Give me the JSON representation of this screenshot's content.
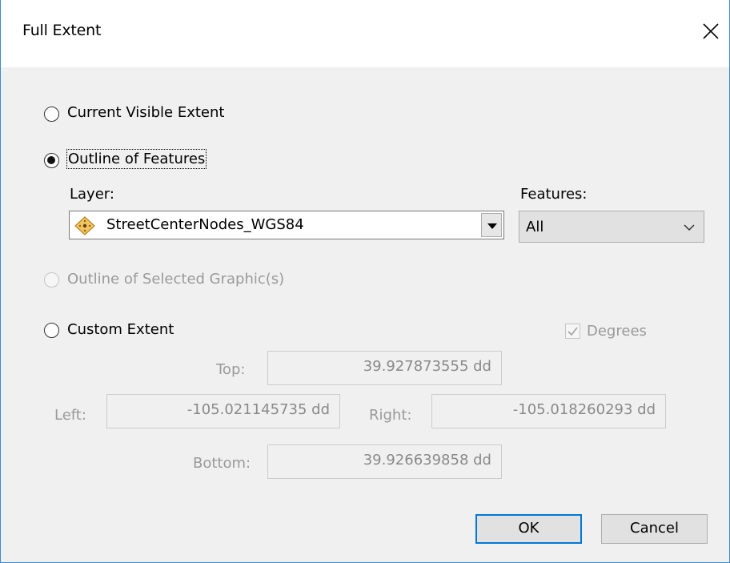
{
  "dialog": {
    "title": "Full Extent"
  },
  "options": {
    "current_visible_extent": "Current Visible Extent",
    "outline_of_features": "Outline of Features",
    "outline_of_selected_graphics": "Outline of Selected Graphic(s)",
    "custom_extent": "Custom Extent"
  },
  "layer": {
    "label": "Layer:",
    "value": "StreetCenterNodes_WGS84"
  },
  "features": {
    "label": "Features:",
    "value": "All"
  },
  "degrees": {
    "label": "Degrees",
    "checked": true
  },
  "extent": {
    "top_label": "Top:",
    "top_value": "39.927873555 dd",
    "left_label": "Left:",
    "left_value": "-105.021145735 dd",
    "right_label": "Right:",
    "right_value": "-105.018260293 dd",
    "bottom_label": "Bottom:",
    "bottom_value": "39.926639858 dd"
  },
  "buttons": {
    "ok": "OK",
    "cancel": "Cancel"
  },
  "colors": {
    "accent": "#0078d7",
    "layer_icon": "#e8b84a"
  }
}
